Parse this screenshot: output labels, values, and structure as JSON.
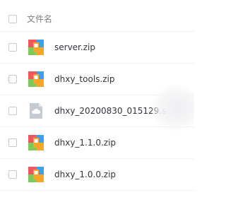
{
  "header": {
    "label": "文件名"
  },
  "files": [
    {
      "name": "server.zip",
      "icon": "archive-icon"
    },
    {
      "name": "dhxy_tools.zip",
      "icon": "archive-icon"
    },
    {
      "name": "dhxy_20200830_015129.s",
      "icon": "cloud-file-icon"
    },
    {
      "name": "dhxy_1.1.0.zip",
      "icon": "archive-icon"
    },
    {
      "name": "dhxy_1.0.0.zip",
      "icon": "archive-icon"
    }
  ],
  "colors": {
    "archive_red": "#f0575a",
    "archive_blue": "#3fa1ee",
    "archive_green": "#7ccb5a",
    "archive_orange": "#f6a629",
    "cloud_file": "#c5cad3"
  }
}
